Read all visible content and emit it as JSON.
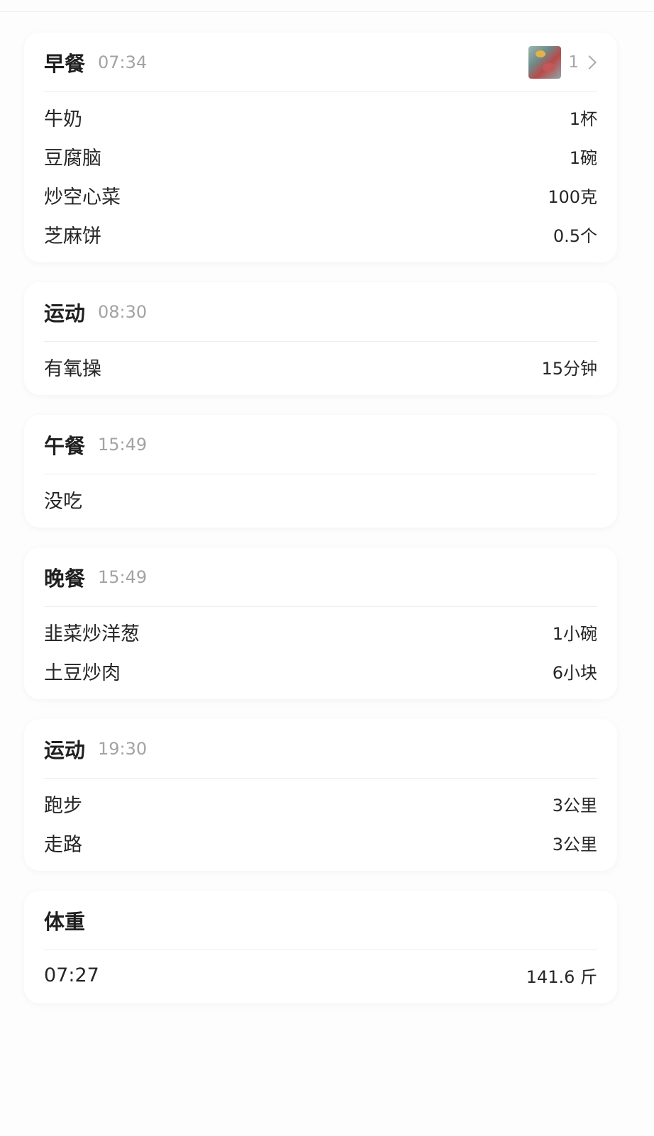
{
  "sections": [
    {
      "title": "早餐",
      "time": "07:34",
      "photo_count": "1",
      "items": [
        {
          "name": "牛奶",
          "qty": "1杯"
        },
        {
          "name": "豆腐脑",
          "qty": "1碗"
        },
        {
          "name": "炒空心菜",
          "qty": "100克"
        },
        {
          "name": "芝麻饼",
          "qty": "0.5个"
        }
      ]
    },
    {
      "title": "运动",
      "time": "08:30",
      "items": [
        {
          "name": "有氧操",
          "qty": "15分钟"
        }
      ]
    },
    {
      "title": "午餐",
      "time": "15:49",
      "items": [
        {
          "name": "没吃",
          "qty": ""
        }
      ]
    },
    {
      "title": "晚餐",
      "time": "15:49",
      "items": [
        {
          "name": "韭菜炒洋葱",
          "qty": "1小碗"
        },
        {
          "name": "土豆炒肉",
          "qty": "6小块"
        }
      ]
    },
    {
      "title": "运动",
      "time": "19:30",
      "items": [
        {
          "name": "跑步",
          "qty": "3公里"
        },
        {
          "name": "走路",
          "qty": "3公里"
        }
      ]
    },
    {
      "title": "体重",
      "time": "",
      "items": [
        {
          "name": "07:27",
          "qty": "141.6 斤"
        }
      ]
    }
  ],
  "icons": {
    "photo": "photo-thumbnail",
    "chevron": "chevron-right-icon"
  }
}
